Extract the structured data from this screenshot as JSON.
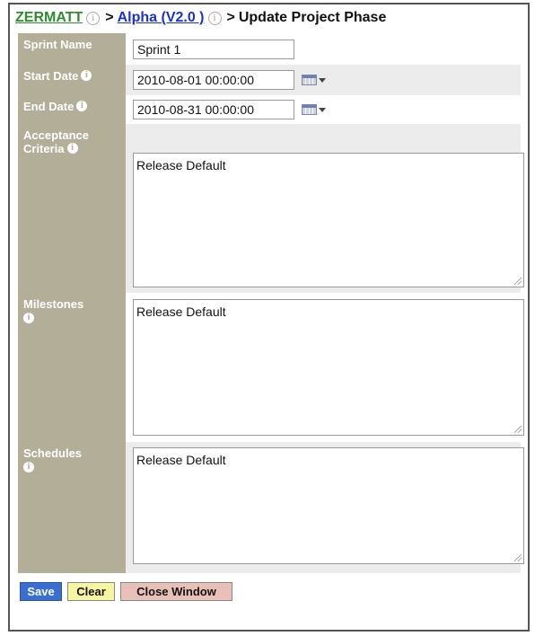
{
  "breadcrumb": {
    "root": "ZERMATT",
    "separator": ">",
    "release": "Alpha (V2.0 )",
    "current": "Update Project Phase"
  },
  "icons": {
    "info_outline": "i",
    "info_solid": "i"
  },
  "form": {
    "sprint_name": {
      "label": "Sprint Name",
      "value": "Sprint 1"
    },
    "start_date": {
      "label": "Start Date",
      "value": "2010-08-01 00:00:00"
    },
    "end_date": {
      "label": "End Date",
      "value": "2010-08-31 00:00:00"
    },
    "acceptance_criteria": {
      "label_line1": "Acceptance",
      "label_line2": "Criteria",
      "value": "Release Default"
    },
    "milestones": {
      "label": "Milestones",
      "value": "Release Default"
    },
    "schedules": {
      "label": "Schedules",
      "value": "Release Default"
    }
  },
  "buttons": {
    "save": "Save",
    "clear": "Clear",
    "close_window": "Close Window"
  },
  "colors": {
    "label_bg": "#b3ae98",
    "alt_row_bg": "#ececec",
    "root_link": "#2e8b2e",
    "release_link": "#1a33cc",
    "save_bg": "#3a6fd0",
    "clear_bg": "#f6f6a0",
    "close_bg": "#e8c0b8"
  }
}
